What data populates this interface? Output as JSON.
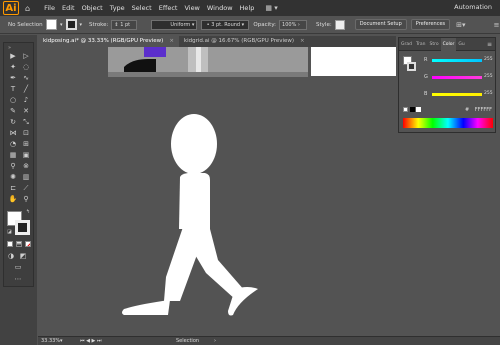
{
  "app": {
    "logo": "Ai",
    "workspace": "Automation"
  },
  "menu": [
    "File",
    "Edit",
    "Object",
    "Type",
    "Select",
    "Effect",
    "View",
    "Window",
    "Help"
  ],
  "control": {
    "selection": "No Selection",
    "stroke_label": "Stroke:",
    "stroke_value": "1 pt",
    "profile": "Uniform",
    "brush": "3 pt. Round",
    "opacity_label": "Opacity:",
    "opacity_value": "100%",
    "style_label": "Style:",
    "doc_setup": "Document Setup",
    "preferences": "Preferences"
  },
  "tabs": [
    {
      "label": "kidposing.ai* @ 33.33% (RGB/GPU Preview)",
      "close": "×"
    },
    {
      "label": "kidgrid.ai @ 16.67% (RGB/GPU Preview)",
      "close": "×"
    }
  ],
  "status": {
    "zoom": "33.33%",
    "mode": "Selection"
  },
  "color_panel": {
    "tabs": [
      "Grad",
      "Tran",
      "Stro",
      "Color",
      "Gu"
    ],
    "channels": [
      {
        "label": "R",
        "value": "255",
        "color": "#00c3ff"
      },
      {
        "label": "G",
        "value": "255",
        "color": "#ff3cdc"
      },
      {
        "label": "B",
        "value": "255",
        "color": "#ffee00"
      }
    ],
    "hex_label": "#",
    "hex_value": "FFFFFF"
  },
  "colors": {
    "fill": "#ffffff",
    "canvas_bg": "#535353",
    "figure": "#ffffff",
    "pants": "#5b2ecc"
  }
}
